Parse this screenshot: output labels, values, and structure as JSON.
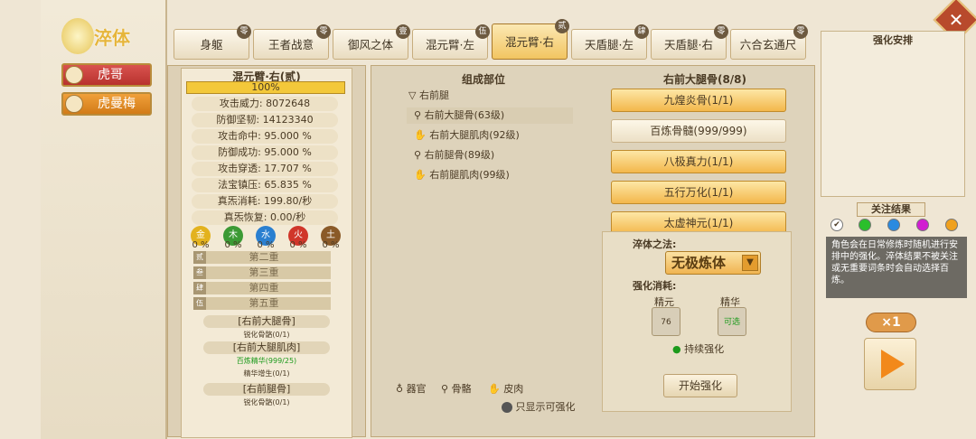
{
  "app": {
    "title": "淬体"
  },
  "characters": [
    {
      "name": "虎哥"
    },
    {
      "name": "虎曼梅"
    }
  ],
  "tabs": [
    {
      "label": "身躯",
      "badge": "零"
    },
    {
      "label": "王者战意",
      "badge": "零"
    },
    {
      "label": "御风之体",
      "badge": "壹"
    },
    {
      "label": "混元臂·左",
      "badge": "伍"
    },
    {
      "label": "混元臂·右",
      "badge": "贰"
    },
    {
      "label": "天盾腿·左",
      "badge": "肆"
    },
    {
      "label": "天盾腿·右",
      "badge": "零"
    },
    {
      "label": "六合玄通尺",
      "badge": "零"
    }
  ],
  "close_label": "✕",
  "stats": {
    "title": "混元臂·右(贰)",
    "progress": "100%",
    "progress_value": 1.0,
    "rows": [
      "攻击威力: 8072648",
      "防御坚韧: 14123340",
      "攻击命中: 95.000 %",
      "防御成功: 95.000 %",
      "攻击穿透: 17.707 %",
      "法宝镇压: 65.835 %",
      "真炁消耗: 199.80/秒",
      "真炁恢复: 0.00/秒"
    ],
    "elements": [
      {
        "char": "金",
        "pct": "0 %",
        "color": "#e3b21e"
      },
      {
        "char": "木",
        "pct": "0 %",
        "color": "#3c9a35"
      },
      {
        "char": "水",
        "pct": "0 %",
        "color": "#2a7fd0"
      },
      {
        "char": "火",
        "pct": "0 %",
        "color": "#d0362a"
      },
      {
        "char": "土",
        "pct": "0 %",
        "color": "#8a5a28"
      }
    ],
    "layers": [
      {
        "n": "贰",
        "label": "第二重"
      },
      {
        "n": "叁",
        "label": "第三重"
      },
      {
        "n": "肆",
        "label": "第四重"
      },
      {
        "n": "伍",
        "label": "第五重"
      }
    ],
    "reqs": [
      {
        "name": "[右前大腿骨]",
        "sub": "锐化骨骼(0/1)",
        "sub_color": "#4a3a24"
      },
      {
        "name": "[右前大腿肌肉]",
        "sub": "百炼精华(999/25)",
        "sub_color": "#1c9a1c"
      },
      {
        "name": "",
        "sub": "精华增生(0/1)",
        "sub_color": "#4a3a24"
      },
      {
        "name": "[右前腿骨]",
        "sub": "锐化骨骼(0/1)",
        "sub_color": "#4a3a24"
      }
    ]
  },
  "parts": {
    "title": "组成部位",
    "group": "右前腿",
    "items": [
      "右前大腿骨(63级)",
      "右前大腿肌肉(92级)",
      "右前腿骨(89级)",
      "右前腿肌肉(99级)"
    ],
    "legend": [
      "器官",
      "骨骼",
      "皮肉"
    ],
    "toggle_label": "只显示可强化"
  },
  "bones": {
    "title": "右前大腿骨(8/8)",
    "skills": [
      "九煌炎骨(1/1)",
      "百炼骨髓(999/999)",
      "八极真力(1/1)",
      "五行万化(1/1)",
      "太虚神元(1/1)"
    ]
  },
  "detail": {
    "method_label": "淬体之法:",
    "method_value": "无极炼体",
    "cost_label": "强化消耗:",
    "cost1_name": "精元",
    "cost1_value": "76",
    "cost2_name": "精华",
    "cost2_value": "可选",
    "continuous": "持续强化",
    "start": "开始强化"
  },
  "arrangement": {
    "title": "强化安排"
  },
  "focus": {
    "title": "关注结果",
    "colors": [
      "#ffffff",
      "#2bbf2b",
      "#2a8ae0",
      "#d11ed1",
      "#f0a11e"
    ],
    "check": "✔",
    "desc": "角色会在日常修炼时随机进行安排中的强化。淬体结果不被关注或无重要词条时会自动选择百炼。"
  },
  "multiplier": "×1"
}
